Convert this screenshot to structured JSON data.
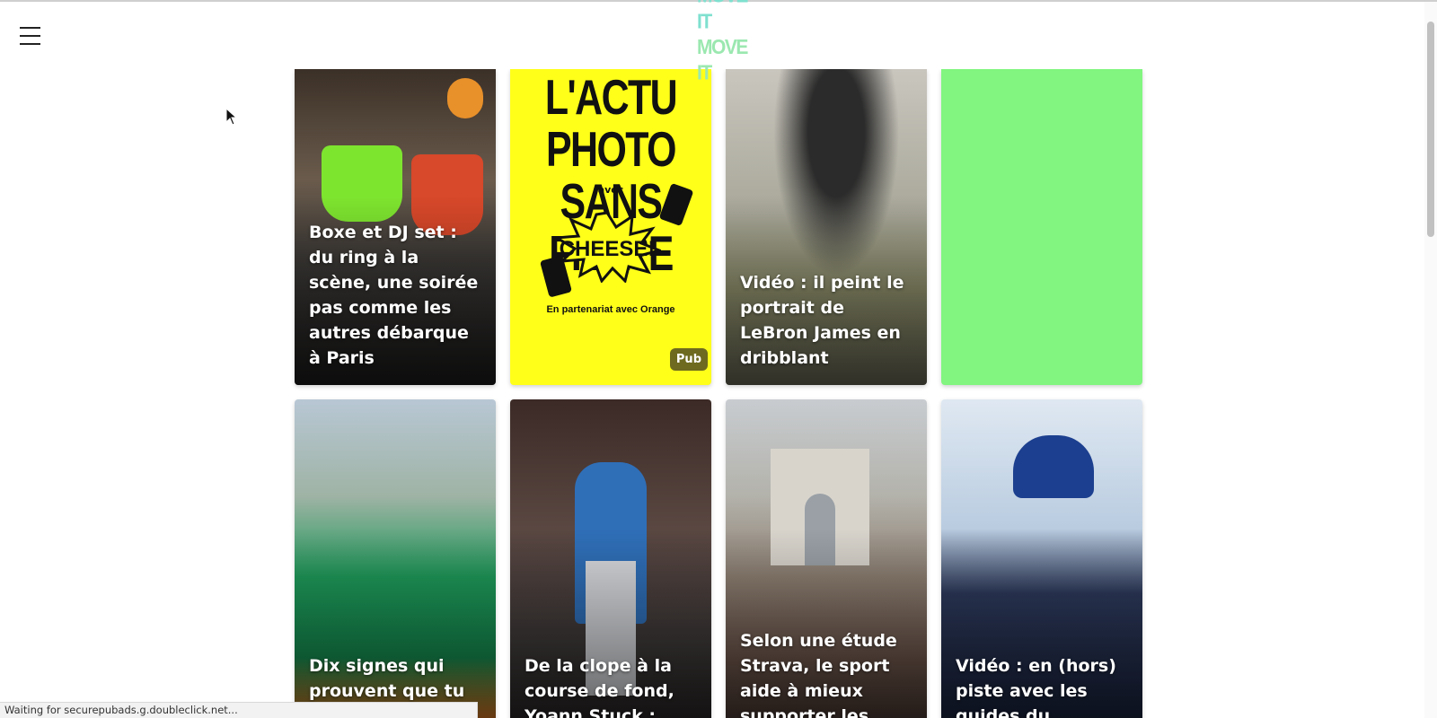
{
  "header": {
    "logo_line1": "MOVE IT",
    "logo_line2": "MOVE IT"
  },
  "cards": [
    {
      "title": "Boxe et DJ set : du ring à la scène, une soirée pas comme les autres débarque à Paris"
    },
    {
      "title": ""
    },
    {
      "title": "Vidéo : il peint le portrait de LeBron James en dribblant"
    },
    {
      "title": ""
    },
    {
      "title": "Dix signes qui prouvent que tu as"
    },
    {
      "title": "De la clope à la course de fond, Yoann Stuck :"
    },
    {
      "title": "Selon une étude Strava, le sport aide à mieux supporter les"
    },
    {
      "title": "Vidéo : en (hors) piste avec les guides du Freeride"
    }
  ],
  "pub": {
    "headline_line1": "L'ACTU PHOTO",
    "headline_line2": "SANS FILTRE",
    "avec": "avec",
    "brand": "CHEESE!",
    "partner": "En partenariat avec Orange",
    "badge": "Pub"
  },
  "status": {
    "text": "Waiting for securepubads.g.doubleclick.net..."
  },
  "colors": {
    "logo": "#7fe0cf",
    "pub_bg": "#ffff1a",
    "green_card": "#81f57f"
  }
}
